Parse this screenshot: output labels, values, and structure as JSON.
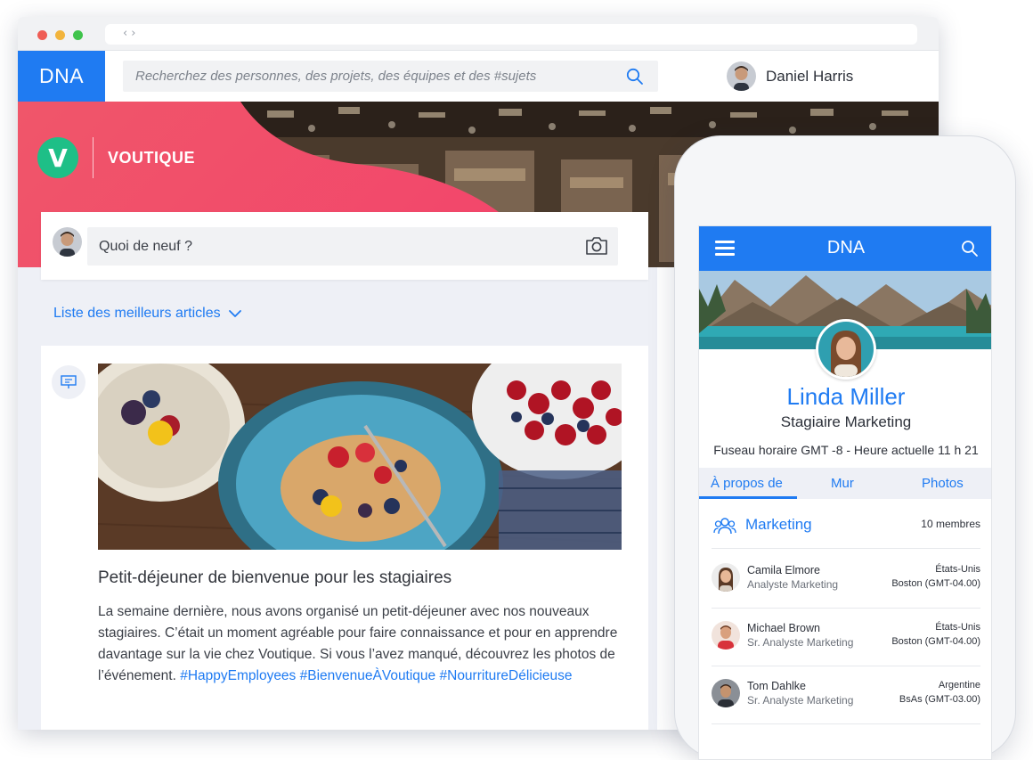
{
  "app": {
    "logo": "DNA",
    "search_placeholder": "Recherchez des personnes, des projets, des équipes et des #sujets",
    "user": {
      "first_name": "Daniel",
      "last_name": "Harris"
    }
  },
  "brand": {
    "initial": "V",
    "name": "VOUTIQUE"
  },
  "composer": {
    "placeholder": "Quoi de neuf ?"
  },
  "feed": {
    "top_articles_label": "Liste des meilleurs articles",
    "article": {
      "title": "Petit-déjeuner de bienvenue pour les stagiaires",
      "body": "La semaine dernière, nous avons organisé un petit-déjeuner avec nos nouveaux stagiaires. C’était un moment agréable pour faire connaissance et pour en apprendre davantage sur la vie chez Voutique. Si vous l’avez manqué, découvrez les photos de l’événement.",
      "hashtags": [
        "#HappyEmployees",
        "#BienvenueÀVoutique",
        "#NourritureDélicieuse"
      ]
    }
  },
  "mobile": {
    "logo": "DNA",
    "profile": {
      "name": "Linda Miller",
      "role": "Stagiaire Marketing",
      "timezone": "Fuseau horaire GMT -8  -  Heure actuelle 11 h 21"
    },
    "tabs": [
      "À propos de",
      "Mur",
      "Photos"
    ],
    "team": {
      "name": "Marketing",
      "count": "10 membres"
    },
    "members": [
      {
        "name": "Camila Elmore",
        "role": "Analyste Marketing",
        "country": "États-Unis",
        "city": "Boston (GMT-04.00)"
      },
      {
        "name": "Michael Brown",
        "role": "Sr. Analyste Marketing",
        "country": "États-Unis",
        "city": "Boston (GMT-04.00)"
      },
      {
        "name": "Tom Dahlke",
        "role": "Sr. Analyste Marketing",
        "country": "Argentine",
        "city": "BsAs (GMT-03.00)"
      }
    ]
  },
  "colors": {
    "accent": "#1f7bf2",
    "brand_green": "#1ebf87",
    "hero_gradient_start": "#f0566a",
    "hero_gradient_end": "#f2476b"
  }
}
